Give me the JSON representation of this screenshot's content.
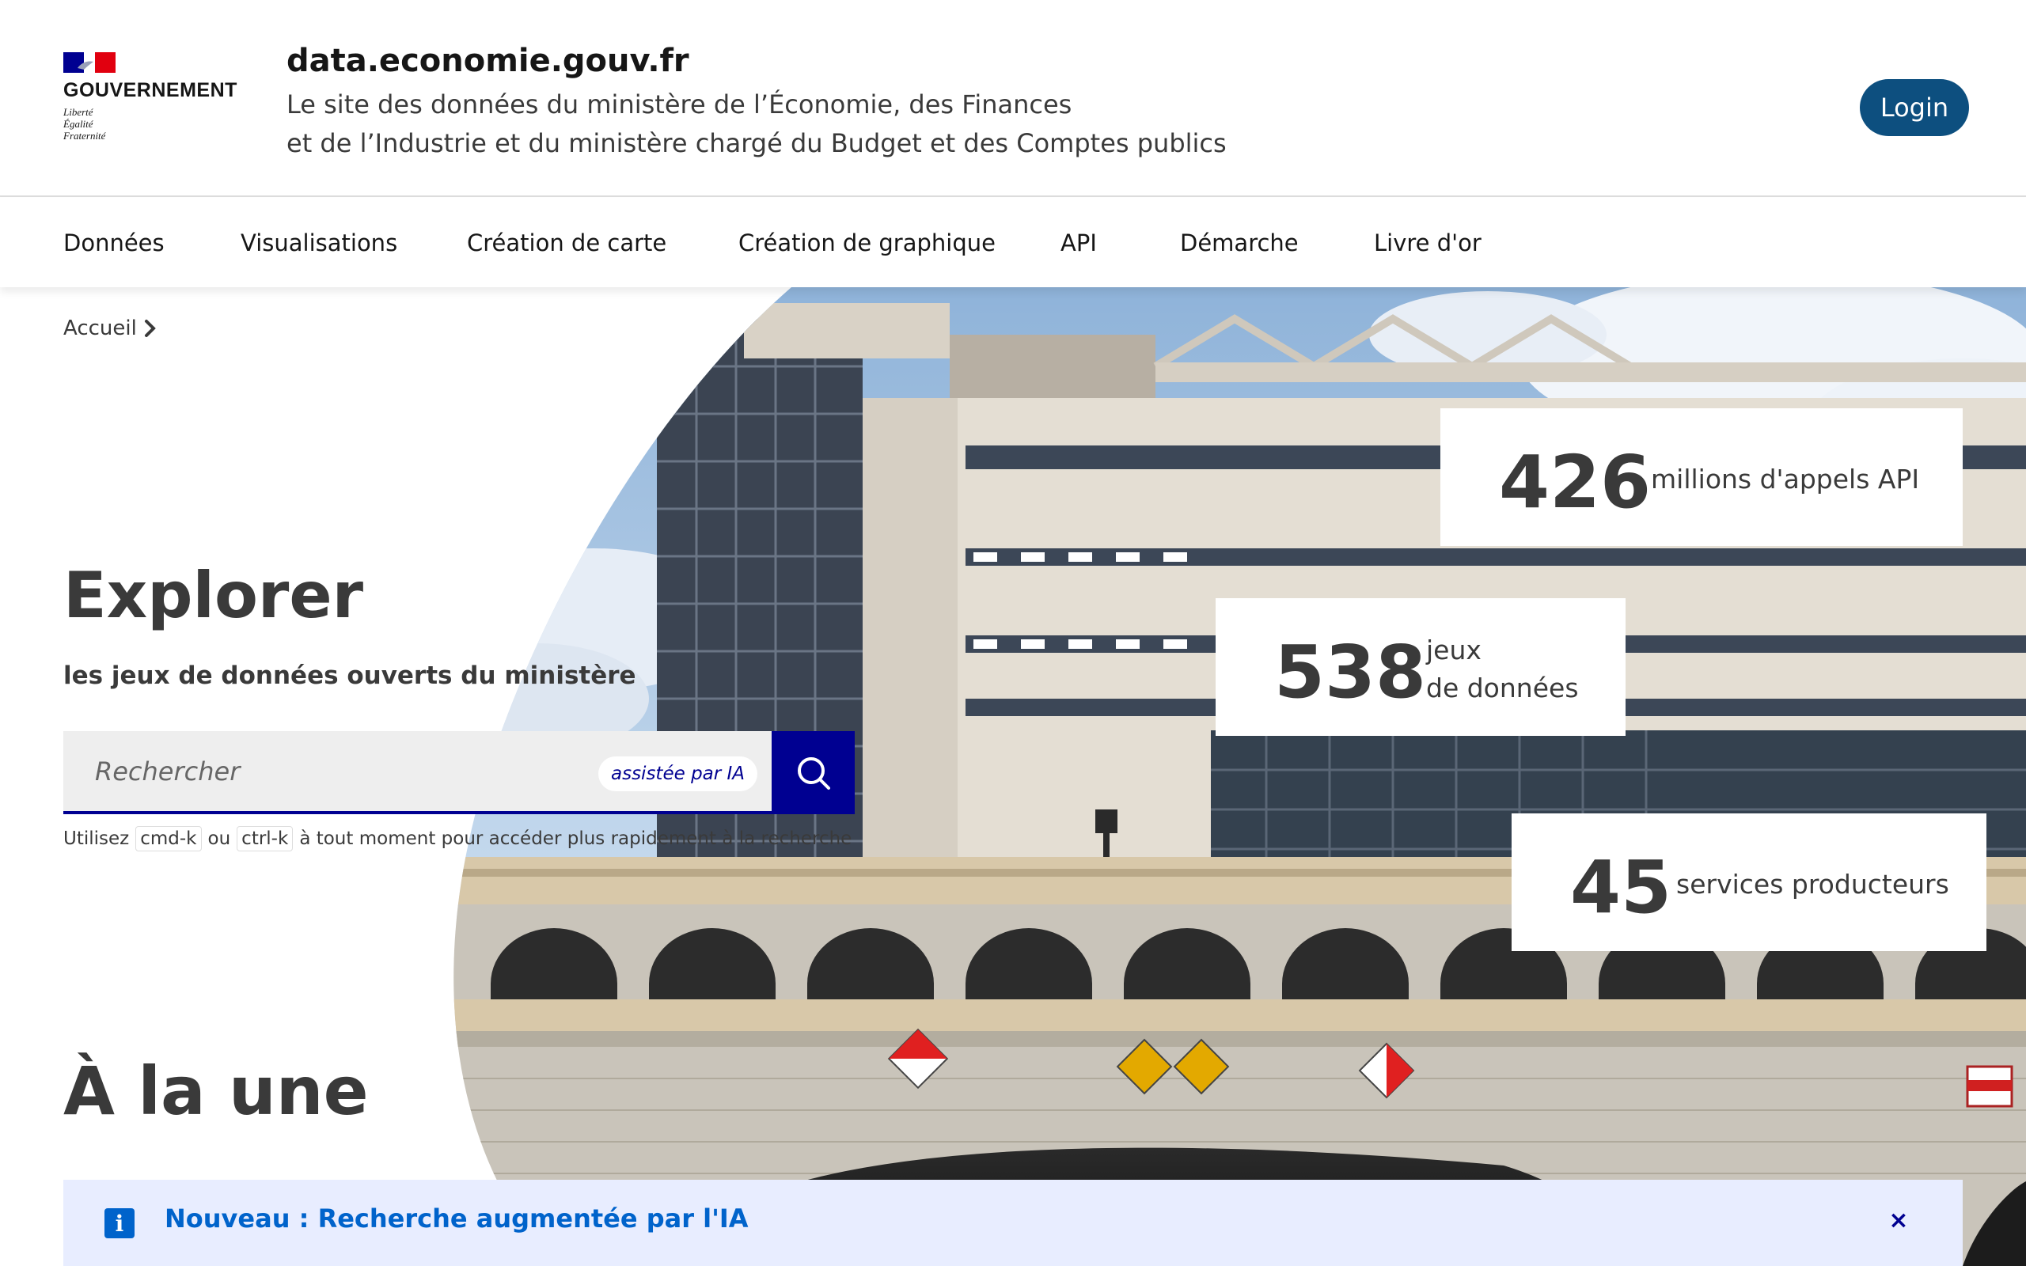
{
  "header": {
    "gov_name": "GOUVERNEMENT",
    "motto": [
      "Liberté",
      "Égalité",
      "Fraternité"
    ],
    "site_title": "data.economie.gouv.fr",
    "tagline_line1": "Le site des données du ministère de l’Économie, des Finances",
    "tagline_line2": "et de l’Industrie et du ministère chargé du Budget et des Comptes publics",
    "login_label": "Login"
  },
  "nav": {
    "items": [
      {
        "label": "Données"
      },
      {
        "label": "Visualisations"
      },
      {
        "label": "Création de carte"
      },
      {
        "label": "Création de graphique"
      },
      {
        "label": "API"
      },
      {
        "label": "Démarche"
      },
      {
        "label": "Livre d'or"
      }
    ]
  },
  "breadcrumb": {
    "home": "Accueil"
  },
  "hero": {
    "title": "Explorer",
    "subtitle": "les jeux de données ouverts du ministère",
    "search_placeholder": "Rechercher",
    "ai_badge": "assistée par IA",
    "hint_before": "Utilisez",
    "hint_key1": "cmd-k",
    "hint_or": "ou",
    "hint_key2": "ctrl-k",
    "hint_after": "à tout moment pour accéder plus rapidement à la recherche"
  },
  "stats": [
    {
      "number": "426",
      "label": "millions d'appels API"
    },
    {
      "number": "538",
      "label_line1": "jeux",
      "label_line2": "de données"
    },
    {
      "number": "45",
      "label": "services producteurs"
    }
  ],
  "featured": {
    "title": "À la une"
  },
  "notice": {
    "icon_letter": "i",
    "text": "Nouveau : Recherche augmentée par l'IA",
    "close": "×"
  },
  "colors": {
    "primary_blue": "#000091",
    "login_blue": "#0d4f7f",
    "notice_bg": "#e8edff",
    "notice_text": "#0063cb",
    "flag_blue": "#000091",
    "flag_red": "#e1000f"
  },
  "icons": {
    "search": "search-icon",
    "notice": "info-icon",
    "close": "close-icon",
    "breadcrumb": "chevron-right-icon"
  }
}
